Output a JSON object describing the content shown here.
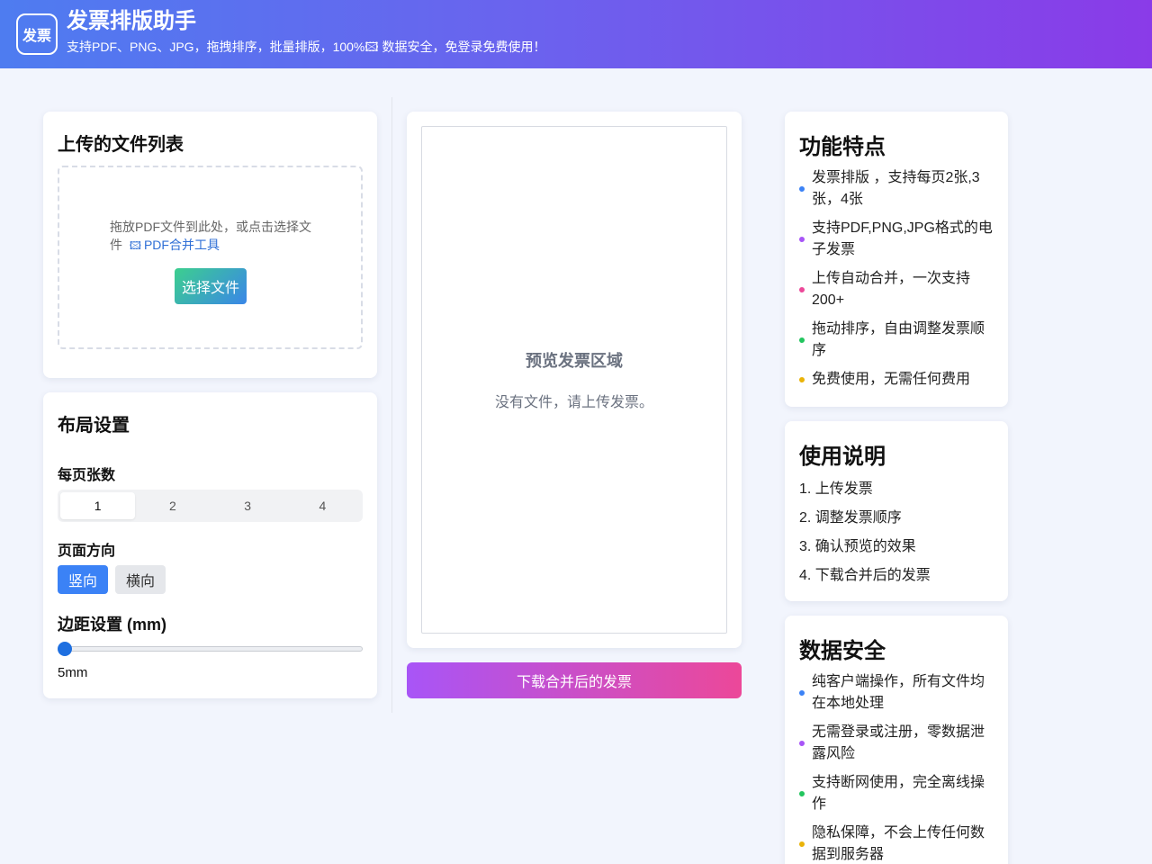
{
  "header": {
    "logo_text": "发票",
    "title": "发票排版助手",
    "subtitle": "支持PDF、PNG、JPG，拖拽排序，批量排版，100%🖾 数据安全，免登录免费使用！"
  },
  "upload": {
    "title": "上传的文件列表",
    "drop_text": "拖放PDF文件到此处，或点击选择文件",
    "pdf_tool_icon": "🖾",
    "pdf_tool_link": "PDF合并工具",
    "choose_button": "选择文件"
  },
  "layout": {
    "title": "布局设置",
    "per_page_label": "每页张数",
    "per_page_options": [
      "1",
      "2",
      "3",
      "4"
    ],
    "per_page_selected": "1",
    "orientation_label": "页面方向",
    "orientation_portrait": "竖向",
    "orientation_landscape": "横向",
    "orientation_selected": "竖向",
    "margin_label": "边距设置 (mm)",
    "margin_value": "5mm",
    "margin_slider_fraction": 0
  },
  "preview": {
    "title": "预览发票区域",
    "empty_text": "没有文件，请上传发票。",
    "download_button": "下载合并后的发票"
  },
  "features": {
    "title": "功能特点",
    "items": [
      {
        "text": "发票排版 ，支持每页2张,3张，4张",
        "color": "#3b82f6"
      },
      {
        "text": "支持PDF,PNG,JPG格式的电子发票",
        "color": "#a855f7"
      },
      {
        "text": "上传自动合并，一次支持200+",
        "color": "#ec4899"
      },
      {
        "text": "拖动排序，自由调整发票顺序",
        "color": "#22c55e"
      },
      {
        "text": "免费使用，无需任何费用",
        "color": "#eab308"
      }
    ]
  },
  "guide": {
    "title": "使用说明",
    "steps": [
      "1. 上传发票",
      "2. 调整发票顺序",
      "3. 确认预览的效果",
      "4. 下载合并后的发票"
    ]
  },
  "security": {
    "title": "数据安全",
    "items": [
      {
        "text": "纯客户端操作，所有文件均在本地处理",
        "color": "#3b82f6"
      },
      {
        "text": "无需登录或注册，零数据泄露风险",
        "color": "#a855f7"
      },
      {
        "text": "支持断网使用，完全离线操作",
        "color": "#22c55e"
      },
      {
        "text": "隐私保障，不会上传任何数据到服务器",
        "color": "#eab308"
      }
    ]
  }
}
